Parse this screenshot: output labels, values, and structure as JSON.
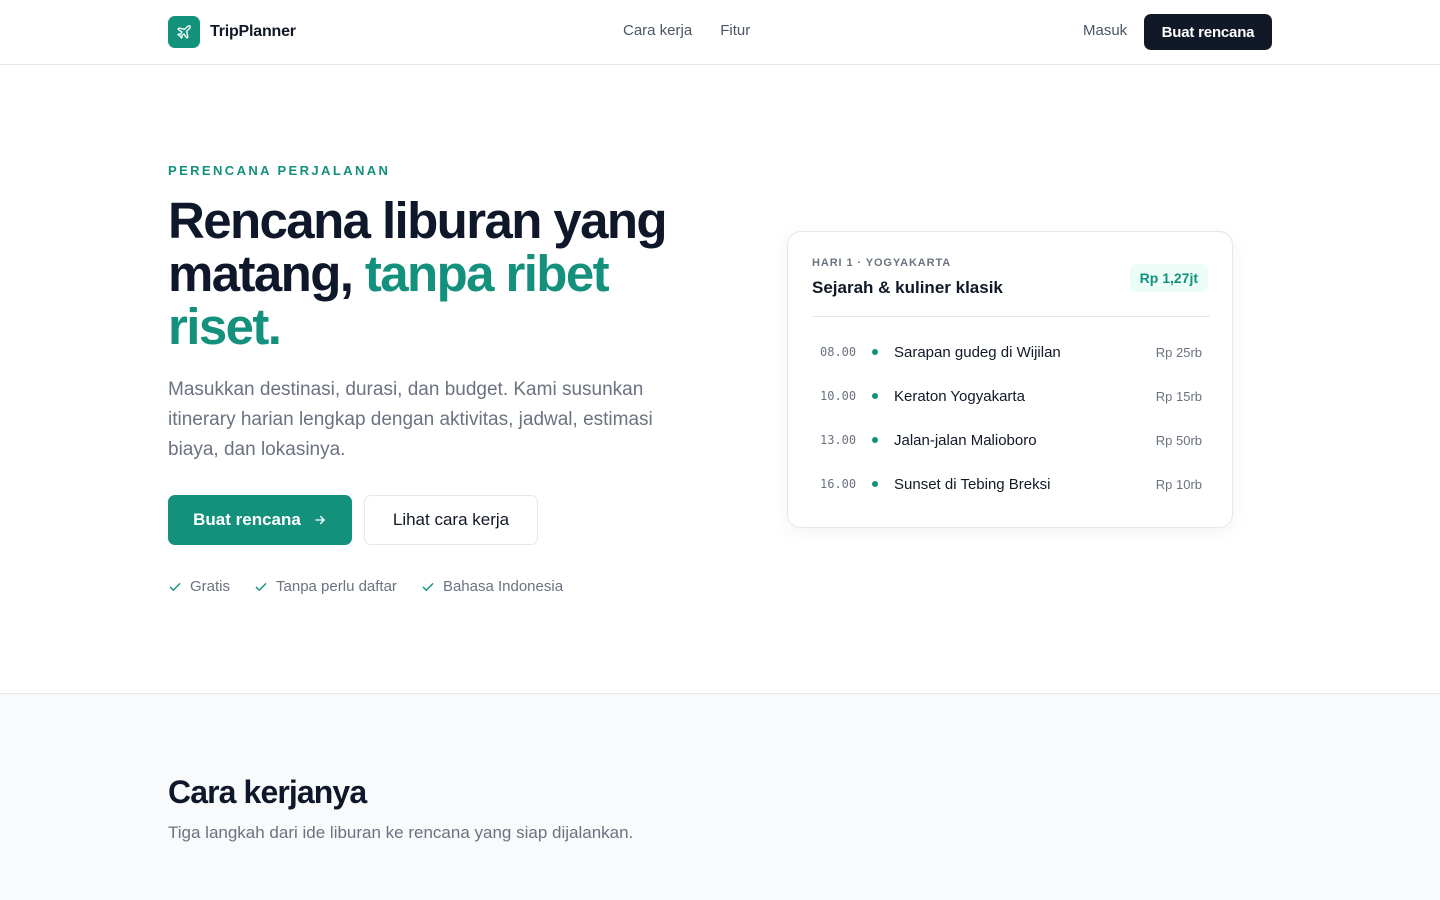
{
  "nav": {
    "brand": "TripPlanner",
    "links": [
      "Cara kerja",
      "Fitur"
    ],
    "login": "Masuk",
    "cta": "Buat rencana"
  },
  "hero": {
    "eyebrow": "PERENCANA PERJALANAN",
    "title_part1": "Rencana liburan yang matang, ",
    "title_accent": "tanpa ribet riset.",
    "description": "Masukkan destinasi, durasi, dan budget. Kami susunkan itinerary harian lengkap dengan aktivitas, jadwal, estimasi biaya, dan lokasinya.",
    "primary_button": "Buat rencana",
    "secondary_button": "Lihat cara kerja",
    "perks": [
      "Gratis",
      "Tanpa perlu daftar",
      "Bahasa Indonesia"
    ]
  },
  "card": {
    "kicker": "HARI 1 · YOGYAKARTA",
    "title": "Sejarah & kuliner klasik",
    "total": "Rp 1,27jt",
    "items": [
      {
        "time": "08.00",
        "name": "Sarapan gudeg di Wijilan",
        "cost": "Rp 25rb"
      },
      {
        "time": "10.00",
        "name": "Keraton Yogyakarta",
        "cost": "Rp 15rb"
      },
      {
        "time": "13.00",
        "name": "Jalan-jalan Malioboro",
        "cost": "Rp 50rb"
      },
      {
        "time": "16.00",
        "name": "Sunset di Tebing Breksi",
        "cost": "Rp 10rb"
      }
    ]
  },
  "how": {
    "title": "Cara kerjanya",
    "subtitle": "Tiga langkah dari ide liburan ke rencana yang siap dijalankan."
  },
  "colors": {
    "accent": "#13917c",
    "dark": "#111827",
    "muted": "#6b7280"
  }
}
